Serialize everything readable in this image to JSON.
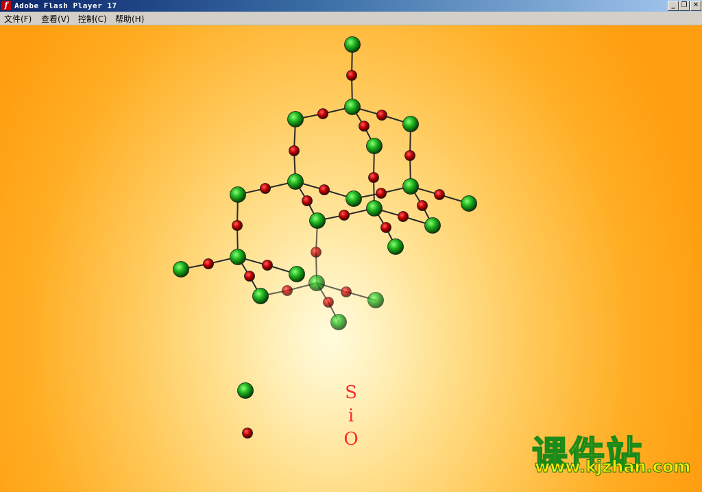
{
  "window": {
    "title": "Adobe Flash Player 17",
    "app_icon_glyph": "f",
    "controls": {
      "minimize": "_",
      "restore": "❐",
      "close": "✕"
    }
  },
  "menu": {
    "items": [
      {
        "label": "文件(F)"
      },
      {
        "label": "查看(V)"
      },
      {
        "label": "控制(C)"
      },
      {
        "label": "帮助(H)"
      }
    ]
  },
  "content": {
    "formula_chars": [
      "S",
      "i",
      "O"
    ],
    "legend": {
      "silicon_label": "",
      "oxygen_label": ""
    },
    "colors": {
      "silicon": "#1fb51f",
      "oxygen": "#c40000",
      "bond": "#2a2a2a",
      "formula": "#ff2a2a"
    },
    "icons": {
      "silicon_atom": "green-sphere-icon",
      "oxygen_atom": "red-sphere-icon"
    }
  },
  "watermark": {
    "text_cn": "课件站",
    "url": "www.kjzhan.com"
  }
}
